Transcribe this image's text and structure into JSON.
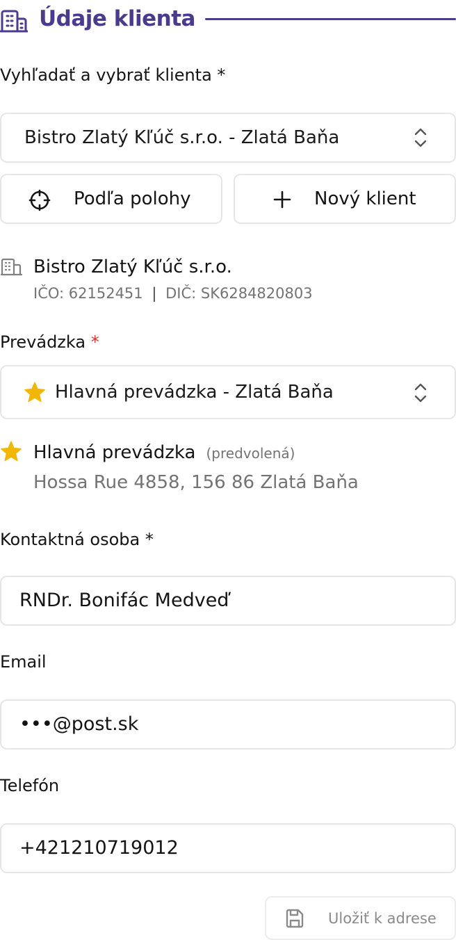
{
  "header": {
    "title": "Údaje klienta",
    "icon": "building-icon",
    "accent": "#4b3b8f"
  },
  "client_search": {
    "label": "Vyhľadať a vybrať klienta *",
    "selected": "Bistro Zlatý Kľúč s.r.o. - Zlatá Baňa"
  },
  "actions": {
    "by_location": "Podľa polohy",
    "new_client": "Nový klient"
  },
  "client_info": {
    "name": "Bistro Zlatý Kľúč s.r.o.",
    "ico": "IČO: 62152451",
    "separator": "|",
    "dic": "DIČ: SK6284820803"
  },
  "establishment": {
    "label": "Prevádzka",
    "required_mark": "*",
    "selected": "Hlavná prevádzka - Zlatá Baňa",
    "detail_name": "Hlavná prevádzka",
    "detail_tag": "(predvolená)",
    "detail_address": "Hossa Rue 4858, 156 86 Zlatá Baňa",
    "star_color": "#f2b705"
  },
  "contact": {
    "label": "Kontaktná osoba *",
    "value": "RNDr. Bonifác Medveď"
  },
  "email": {
    "label": "Email",
    "value": "•••@post.sk"
  },
  "phone": {
    "label": "Telefón",
    "value": "+421210719012"
  },
  "save": {
    "label": "Uložiť k adrese"
  }
}
